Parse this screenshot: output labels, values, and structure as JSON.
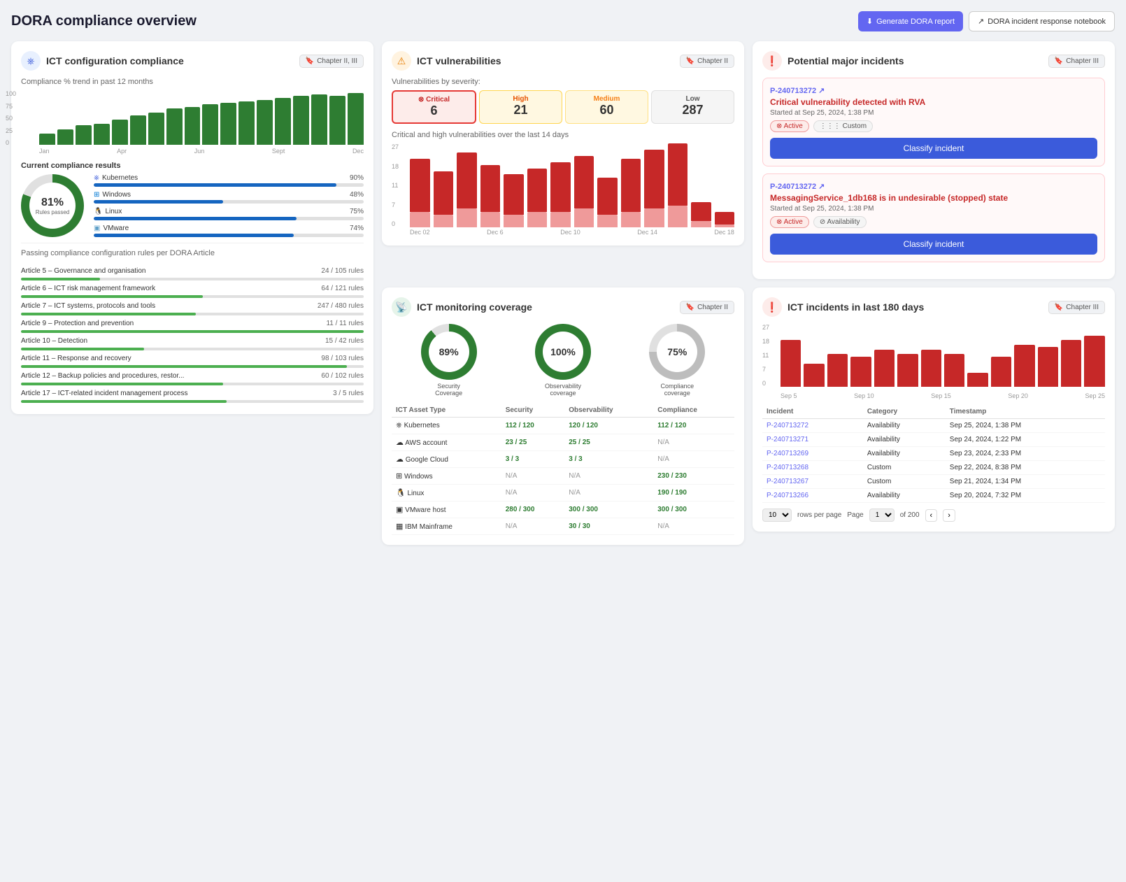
{
  "page": {
    "title": "DORA compliance overview",
    "buttons": {
      "generate": "Generate DORA report",
      "notebook": "DORA incident response notebook"
    }
  },
  "compliance_card": {
    "title": "ICT configuration compliance",
    "chapter_badge": "Chapter II, III",
    "trend_label": "Compliance % trend in past 12 months",
    "chart_bars": [
      20,
      28,
      35,
      38,
      45,
      52,
      58,
      65,
      68,
      72,
      75,
      78,
      80,
      84,
      88,
      90,
      88,
      92
    ],
    "chart_x": [
      "Jan",
      "Apr",
      "Jun",
      "Sept",
      "Dec"
    ],
    "chart_y": [
      "100",
      "75",
      "50",
      "25",
      "0"
    ],
    "current_label": "Current compliance results",
    "donut_pct": "81%",
    "donut_sub": "Rules passed",
    "items": [
      {
        "label": "Kubernetes",
        "pct": 90,
        "pct_label": "90%",
        "icon": "⎈"
      },
      {
        "label": "Windows",
        "pct": 48,
        "pct_label": "48%",
        "icon": "⊞"
      },
      {
        "label": "Linux",
        "pct": 75,
        "pct_label": "75%",
        "icon": "🐧"
      },
      {
        "label": "VMware",
        "pct": 74,
        "pct_label": "74%",
        "icon": "▣"
      }
    ],
    "articles_label": "Passing compliance configuration rules per DORA Article",
    "articles": [
      {
        "name": "Article 5 – Governance and organisation",
        "count": "24 / 105 rules",
        "pct": 23
      },
      {
        "name": "Article 6 – ICT risk management framework",
        "count": "64 / 121 rules",
        "pct": 53
      },
      {
        "name": "Article 7 – ICT systems, protocols and tools",
        "count": "247 / 480 rules",
        "pct": 51
      },
      {
        "name": "Article 9 – Protection and prevention",
        "count": "11 / 11 rules",
        "pct": 100
      },
      {
        "name": "Article 10 – Detection",
        "count": "15 / 42 rules",
        "pct": 36
      },
      {
        "name": "Article 11 – Response and recovery",
        "count": "98 / 103 rules",
        "pct": 95
      },
      {
        "name": "Article 12 – Backup policies and procedures, restor...",
        "count": "60 / 102 rules",
        "pct": 59
      },
      {
        "name": "Article 17 – ICT-related incident management process",
        "count": "3 / 5 rules",
        "pct": 60
      }
    ]
  },
  "vulnerabilities_card": {
    "title": "ICT vulnerabilities",
    "chapter_badge": "Chapter II",
    "severity_label": "Vulnerabilities by severity:",
    "severities": [
      {
        "label": "Critical",
        "count": "6",
        "type": "critical"
      },
      {
        "label": "High",
        "count": "21",
        "type": "high"
      },
      {
        "label": "Medium",
        "count": "60",
        "type": "medium"
      },
      {
        "label": "Low",
        "count": "287",
        "type": "low"
      }
    ],
    "chart_label": "Critical and high vulnerabilities over the last 14 days",
    "chart_bars": [
      {
        "total": 22,
        "light": 5
      },
      {
        "total": 18,
        "light": 4
      },
      {
        "total": 24,
        "light": 6
      },
      {
        "total": 20,
        "light": 5
      },
      {
        "total": 17,
        "light": 4
      },
      {
        "total": 19,
        "light": 5
      },
      {
        "total": 21,
        "light": 5
      },
      {
        "total": 23,
        "light": 6
      },
      {
        "total": 16,
        "light": 4
      },
      {
        "total": 22,
        "light": 5
      },
      {
        "total": 25,
        "light": 6
      },
      {
        "total": 27,
        "light": 7
      },
      {
        "total": 8,
        "light": 2
      },
      {
        "total": 5,
        "light": 1
      }
    ],
    "chart_y": [
      "27",
      "18",
      "11",
      "7",
      "0"
    ],
    "chart_x": [
      "Dec 02",
      "Dec 6",
      "Dec 10",
      "Dec 14",
      "Dec 18"
    ]
  },
  "monitoring_card": {
    "title": "ICT monitoring coverage",
    "chapter_badge": "Chapter II",
    "circles": [
      {
        "pct": 89,
        "label": "Security\nCoverage",
        "color": "#2e7d32",
        "bg_angle": 89
      },
      {
        "pct": 100,
        "label": "Observability\ncoverage",
        "color": "#2e7d32",
        "bg_angle": 100
      },
      {
        "pct": 75,
        "label": "Compliance\ncoverage",
        "color": "#bdbdbd",
        "bg_angle": 75
      }
    ],
    "table_headers": [
      "ICT Asset Type",
      "Security",
      "Observability",
      "Compliance"
    ],
    "table_rows": [
      {
        "asset": "Kubernetes",
        "security": "112 / 120",
        "observability": "120 / 120",
        "compliance": "112 / 120"
      },
      {
        "asset": "AWS account",
        "security": "23 / 25",
        "observability": "25 / 25",
        "compliance": "N/A"
      },
      {
        "asset": "Google Cloud",
        "security": "3 / 3",
        "observability": "3 / 3",
        "compliance": "N/A"
      },
      {
        "asset": "Windows",
        "security": "N/A",
        "observability": "N/A",
        "compliance": "230 / 230"
      },
      {
        "asset": "Linux",
        "security": "N/A",
        "observability": "N/A",
        "compliance": "190 / 190"
      },
      {
        "asset": "VMware host",
        "security": "280 / 300",
        "observability": "300 / 300",
        "compliance": "300 / 300"
      },
      {
        "asset": "IBM Mainframe",
        "security": "N/A",
        "observability": "30 / 30",
        "compliance": "N/A"
      }
    ]
  },
  "major_incidents_card": {
    "title": "Potential major incidents",
    "chapter_badge": "Chapter III",
    "incidents": [
      {
        "id": "P-240713272",
        "title": "Critical vulnerability detected with RVA",
        "started": "Started at Sep 25, 2024, 1:38 PM",
        "badges": [
          "Active",
          "Custom"
        ],
        "btn": "Classify incident"
      },
      {
        "id": "P-240713272",
        "title": "MessagingService_1db168 is in undesirable (stopped) state",
        "started": "Started at Sep 25, 2024, 1:38 PM",
        "badges": [
          "Active",
          "Availability"
        ],
        "btn": "Classify incident"
      }
    ]
  },
  "ict_incidents_card": {
    "title": "ICT incidents in last 180 days",
    "chapter_badge": "Chapter III",
    "chart_bars": [
      20,
      10,
      14,
      13,
      16,
      14,
      16,
      14,
      6,
      13,
      18,
      17,
      20,
      22
    ],
    "chart_y": [
      "27",
      "18",
      "11",
      "7",
      "0"
    ],
    "chart_x": [
      "Sep 5",
      "Sep 10",
      "Sep 15",
      "Sep 20",
      "Sep 25"
    ],
    "table_headers": [
      "Incident",
      "Category",
      "Timestamp"
    ],
    "table_rows": [
      {
        "id": "P-240713272",
        "category": "Availability",
        "timestamp": "Sep 25, 2024, 1:38 PM"
      },
      {
        "id": "P-240713271",
        "category": "Availability",
        "timestamp": "Sep 24, 2024, 1:22 PM"
      },
      {
        "id": "P-240713269",
        "category": "Availability",
        "timestamp": "Sep 23, 2024, 2:33 PM"
      },
      {
        "id": "P-240713268",
        "category": "Custom",
        "timestamp": "Sep 22, 2024, 8:38 PM"
      },
      {
        "id": "P-240713267",
        "category": "Custom",
        "timestamp": "Sep 21, 2024, 1:34 PM"
      },
      {
        "id": "P-240713266",
        "category": "Availability",
        "timestamp": "Sep 20, 2024, 7:32 PM"
      }
    ],
    "rows_per_page": "10",
    "page": "1",
    "total_pages": "200"
  }
}
